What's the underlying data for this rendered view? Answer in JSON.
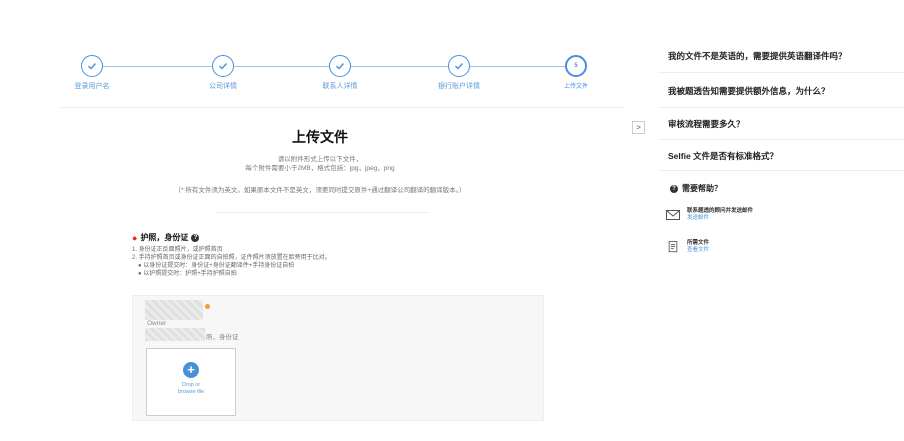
{
  "stepper": {
    "steps": [
      {
        "label": "登录用户名",
        "state": "done"
      },
      {
        "label": "公司详情",
        "state": "done"
      },
      {
        "label": "联系人详情",
        "state": "done"
      },
      {
        "label": "银行账户详情",
        "state": "done"
      },
      {
        "label": "上传文件",
        "state": "current",
        "number": "5"
      }
    ]
  },
  "collapse_button": {
    "glyph": ">"
  },
  "main": {
    "title": "上传文件",
    "subtitle_line1": "请以附件形式上传以下文件，",
    "subtitle_line2": "每个附件需要小于2MB，格式包括：jpg，jpeg，png",
    "note": "（* 所有文件须为英文。如果原本文件不是英文，须要同时提交原件+通过翻译公司翻译的翻译版本。）"
  },
  "section": {
    "title": "护照，身份证",
    "help_glyph": "?",
    "instructions": [
      "1. 身份证正反面照片，或护照首页",
      "2. 手持护照首页或身份证正面的自拍照，证件照片须放置在脸旁用于比对。",
      "● 以身份证提交时：身份证+身份证翻译件+手持身份证自拍",
      "● 以护照提交时：护照+手持护照自拍"
    ]
  },
  "upload": {
    "owner_label": "Owner",
    "owner_doc_suffix": "照，身份证",
    "plus": "+",
    "drop_line1": "Drop or",
    "drop_line2": "browse file"
  },
  "sidebar": {
    "faqs": [
      "我的文件不是英语的，需要提供英语翻译件吗？",
      "我被题透告知需要提供额外信息，为什么？",
      "审核流程需要多久？",
      "Selfie 文件是否有标准格式？"
    ],
    "help": {
      "title": "需要帮助？",
      "items": [
        {
          "icon": "envelope-icon",
          "title": "联系题透的顾问并发送邮件",
          "link": "发送邮件"
        },
        {
          "icon": "document-icon",
          "title": "所需文件",
          "link": "查看文件"
        }
      ]
    }
  },
  "colors": {
    "accent": "#4a90d9",
    "required": "#e03030",
    "warning": "#f0a030"
  }
}
